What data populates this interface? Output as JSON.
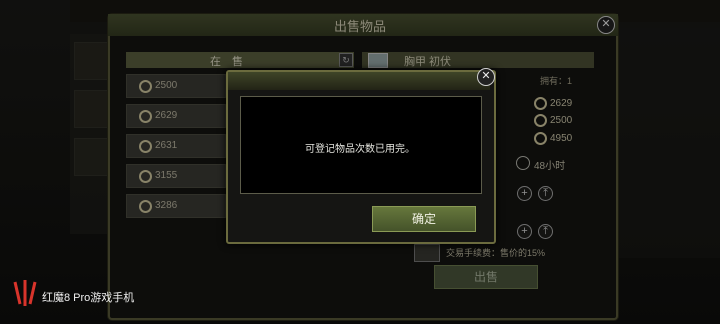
{
  "panel": {
    "title": "出售物品"
  },
  "listing": {
    "title": "在 售",
    "prices": [
      "2500",
      "2629",
      "2631",
      "3155",
      "3286"
    ]
  },
  "item": {
    "name": "胸甲 初伏",
    "owned_label": "拥有：",
    "owned_count": "1",
    "reference_prices": [
      "2629",
      "2500",
      "4950"
    ],
    "duration_label": "48小时"
  },
  "fee": {
    "label": "交易手续费：售价的15%"
  },
  "sell_button": {
    "label": "出售"
  },
  "dialog": {
    "message": "可登记物品次数已用完。",
    "confirm_label": "确定"
  },
  "watermark": {
    "text": "红魔8 Pro游戏手机"
  }
}
